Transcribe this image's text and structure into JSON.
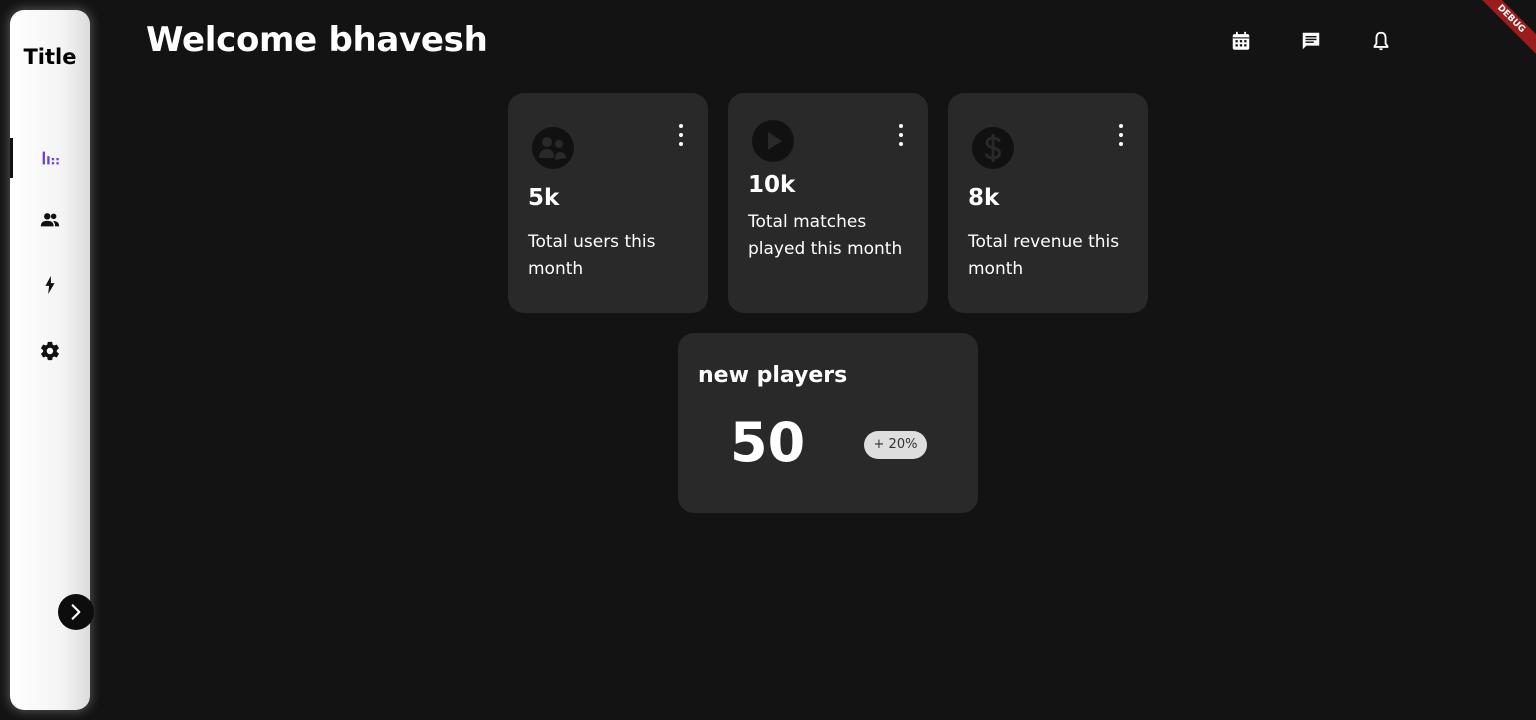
{
  "sidebar": {
    "title": "Title",
    "items": [
      {
        "icon": "bar-chart-icon",
        "active": true,
        "accent": "#6a3fd8"
      },
      {
        "icon": "people-icon",
        "active": false
      },
      {
        "icon": "bolt-icon",
        "active": false
      },
      {
        "icon": "gear-icon",
        "active": false
      }
    ],
    "expand_icon": "chevron-right-icon"
  },
  "header": {
    "title": "Welcome bhavesh",
    "icons": [
      "calendar-icon",
      "chat-icon",
      "bell-icon"
    ]
  },
  "debug_banner": "DEBUG",
  "stats": [
    {
      "icon": "users-icon",
      "value": "5k",
      "label": "Total users this month"
    },
    {
      "icon": "play-icon",
      "value": "10k",
      "label": "Total matches played this month"
    },
    {
      "icon": "dollar-icon",
      "value": "8k",
      "label": "Total revenue this month"
    }
  ],
  "new_players": {
    "title": "new players",
    "count": "50",
    "change": "+ 20%"
  },
  "colors": {
    "background": "#131313",
    "card": "#292929",
    "accent": "#6a3fd8",
    "badge": "#dedede",
    "debug": "#9b1c1c"
  }
}
